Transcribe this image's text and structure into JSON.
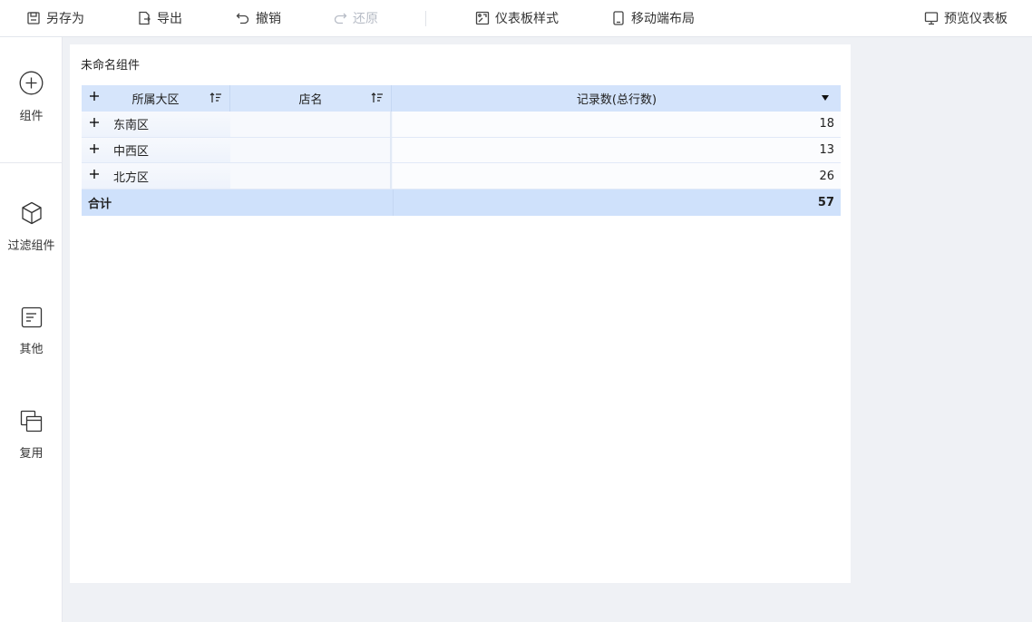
{
  "toolbar": {
    "save_as": "另存为",
    "export": "导出",
    "undo": "撤销",
    "redo": "还原",
    "dashboard_style": "仪表板样式",
    "mobile_layout": "移动端布局",
    "preview": "预览仪表板"
  },
  "sidebar": {
    "items": [
      {
        "label": "组件",
        "icon": "plus-circle-icon"
      },
      {
        "label": "过滤组件",
        "icon": "cube-icon"
      },
      {
        "label": "其他",
        "icon": "document-icon"
      },
      {
        "label": "复用",
        "icon": "copy-icon"
      }
    ]
  },
  "widget": {
    "title": "未命名组件",
    "table": {
      "headers": [
        "所属大区",
        "店名",
        "记录数(总行数)"
      ],
      "rows": [
        {
          "region": "东南区",
          "count": "18"
        },
        {
          "region": "中西区",
          "count": "13"
        },
        {
          "region": "北方区",
          "count": "26"
        }
      ],
      "total_label": "合计",
      "total_value": "57"
    }
  }
}
